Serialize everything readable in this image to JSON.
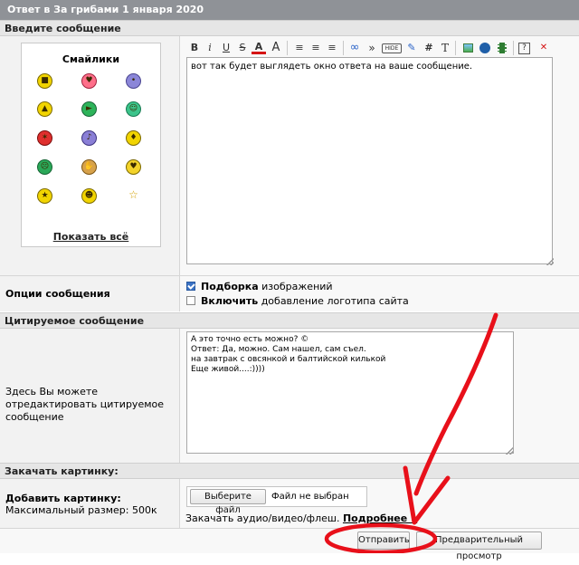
{
  "title": "Ответ в За грибами 1 января 2020",
  "sections": {
    "message": "Введите сообщение",
    "quoted": "Цитируемое сообщение",
    "upload": "Закачать картинку:"
  },
  "smilies": {
    "title": "Смайлики",
    "show_all": "Показать всё",
    "icons": [
      "smiley-cool-icon",
      "smiley-love-icon",
      "smiley-purple-icon",
      "smiley-thumbs-up-icon",
      "smiley-gun-icon",
      "smiley-green-icon",
      "smiley-fight-icon",
      "smiley-dance-icon",
      "smiley-wave-icon",
      "smiley-green-sad-icon",
      "smiley-clap-icon",
      "smiley-hug-icon",
      "smiley-medal-icon",
      "smiley-laugh-icon",
      "star-icon"
    ]
  },
  "toolbar": {
    "buttons": [
      "Bold",
      "Italic",
      "Underline",
      "Strike",
      "Color",
      "Font size",
      "Align left",
      "Align center",
      "Align right",
      "Link",
      "Quote",
      "Hide",
      "Edit",
      "Hash",
      "Text",
      "Image",
      "Flash",
      "Video",
      "Help",
      "Close"
    ],
    "glyphs": {
      "bold": "B",
      "italic": "i",
      "underline": "U",
      "strike": "S",
      "color": "A",
      "size": "A",
      "link": "∞",
      "quote": "»",
      "hide": "HIDE",
      "edit": "✎",
      "hash": "#",
      "text": "T",
      "help": "?",
      "close": "✕"
    }
  },
  "editor": {
    "value": "вот так будет выглядеть окно ответа на ваше сообщение."
  },
  "options": {
    "label": "Опции сообщения",
    "items": [
      {
        "bold": "Подборка",
        "rest": " изображений",
        "checked": true
      },
      {
        "bold": "Включить",
        "rest": " добавление логотипа сайта",
        "checked": false
      }
    ]
  },
  "quote": {
    "help": "Здесь Вы можете отредактировать цитируемое сообщение",
    "value": "А это точно есть можно? ©\nОтвет: Да, можно. Сам нашел, сам съел.\nна завтрак с овсянкой и балтийской килькой\nЕще живой....:))))"
  },
  "upload": {
    "label": "Добавить картинку:",
    "max_size": "Максимальный размер: 500к",
    "choose_file": "Выберите файл",
    "no_file": "Файл не выбран",
    "media_text": "Закачать аудио/видео/флеш.",
    "more_link": "Подробнее »"
  },
  "actions": {
    "submit": "Отправить",
    "preview": "Предварительный просмотр"
  },
  "annotation_color": "#e8101a"
}
